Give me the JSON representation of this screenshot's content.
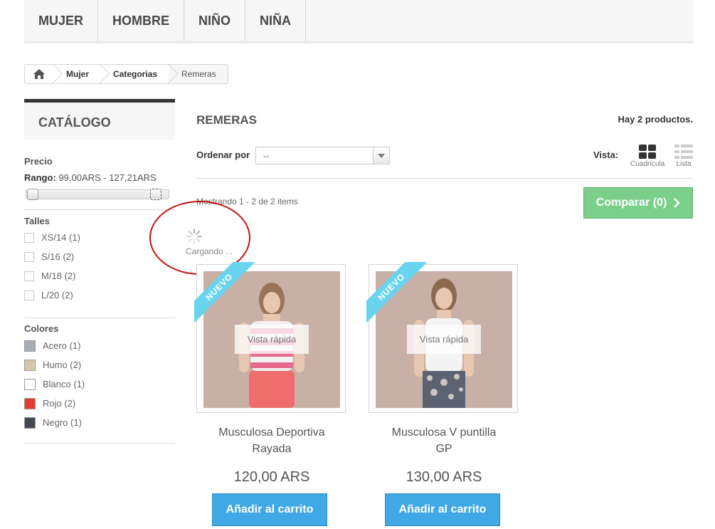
{
  "nav": {
    "items": [
      "MUJER",
      "HOMBRE",
      "NIÑO",
      "NIÑA"
    ]
  },
  "breadcrumb": {
    "home_icon": "home-icon",
    "items": [
      "Mujer",
      "Categorias",
      "Remeras"
    ]
  },
  "sidebar": {
    "title": "CATÁLOGO",
    "precio_label": "Precio",
    "rango_label": "Rango:",
    "rango_value": "99,00ARS - 127,21ARS",
    "talles_label": "Talles",
    "talles": [
      "XS/14 (1)",
      "S/16 (2)",
      "M/18 (2)",
      "L/20 (2)"
    ],
    "colores_label": "Colores",
    "colores": [
      {
        "label": "Acero (1)",
        "color": "#a8aeb8"
      },
      {
        "label": "Humo (2)",
        "color": "#d6c9a8"
      },
      {
        "label": "Blanco (1)",
        "color": "#ffffff"
      },
      {
        "label": "Rojo (2)",
        "color": "#e03e33"
      },
      {
        "label": "Negro (1)",
        "color": "#434a54"
      }
    ]
  },
  "main": {
    "heading": "REMERAS",
    "count_text": "Hay 2 productos.",
    "sort_label": "Ordenar por",
    "sort_value": "--",
    "vista_label": "Vista:",
    "view_grid_label": "Cuadrícula",
    "view_list_label": "Lista",
    "showing_text": "Mostrando 1 - 2 de 2 items",
    "compare_label": "Comparar (0)",
    "loading_text": "Cargando ..."
  },
  "products": [
    {
      "badge": "NUEVO",
      "quick_view": "Vista rápida",
      "name_line1": "Musculosa Deportiva",
      "name_line2": "Rayada",
      "price": "120,00 ARS",
      "cart": "Añadir al carrito"
    },
    {
      "badge": "NUEVO",
      "quick_view": "Vista rápida",
      "name_line1": "Musculosa V puntilla",
      "name_line2": "GP",
      "price": "130,00 ARS",
      "cart": "Añadir al carrito"
    }
  ]
}
